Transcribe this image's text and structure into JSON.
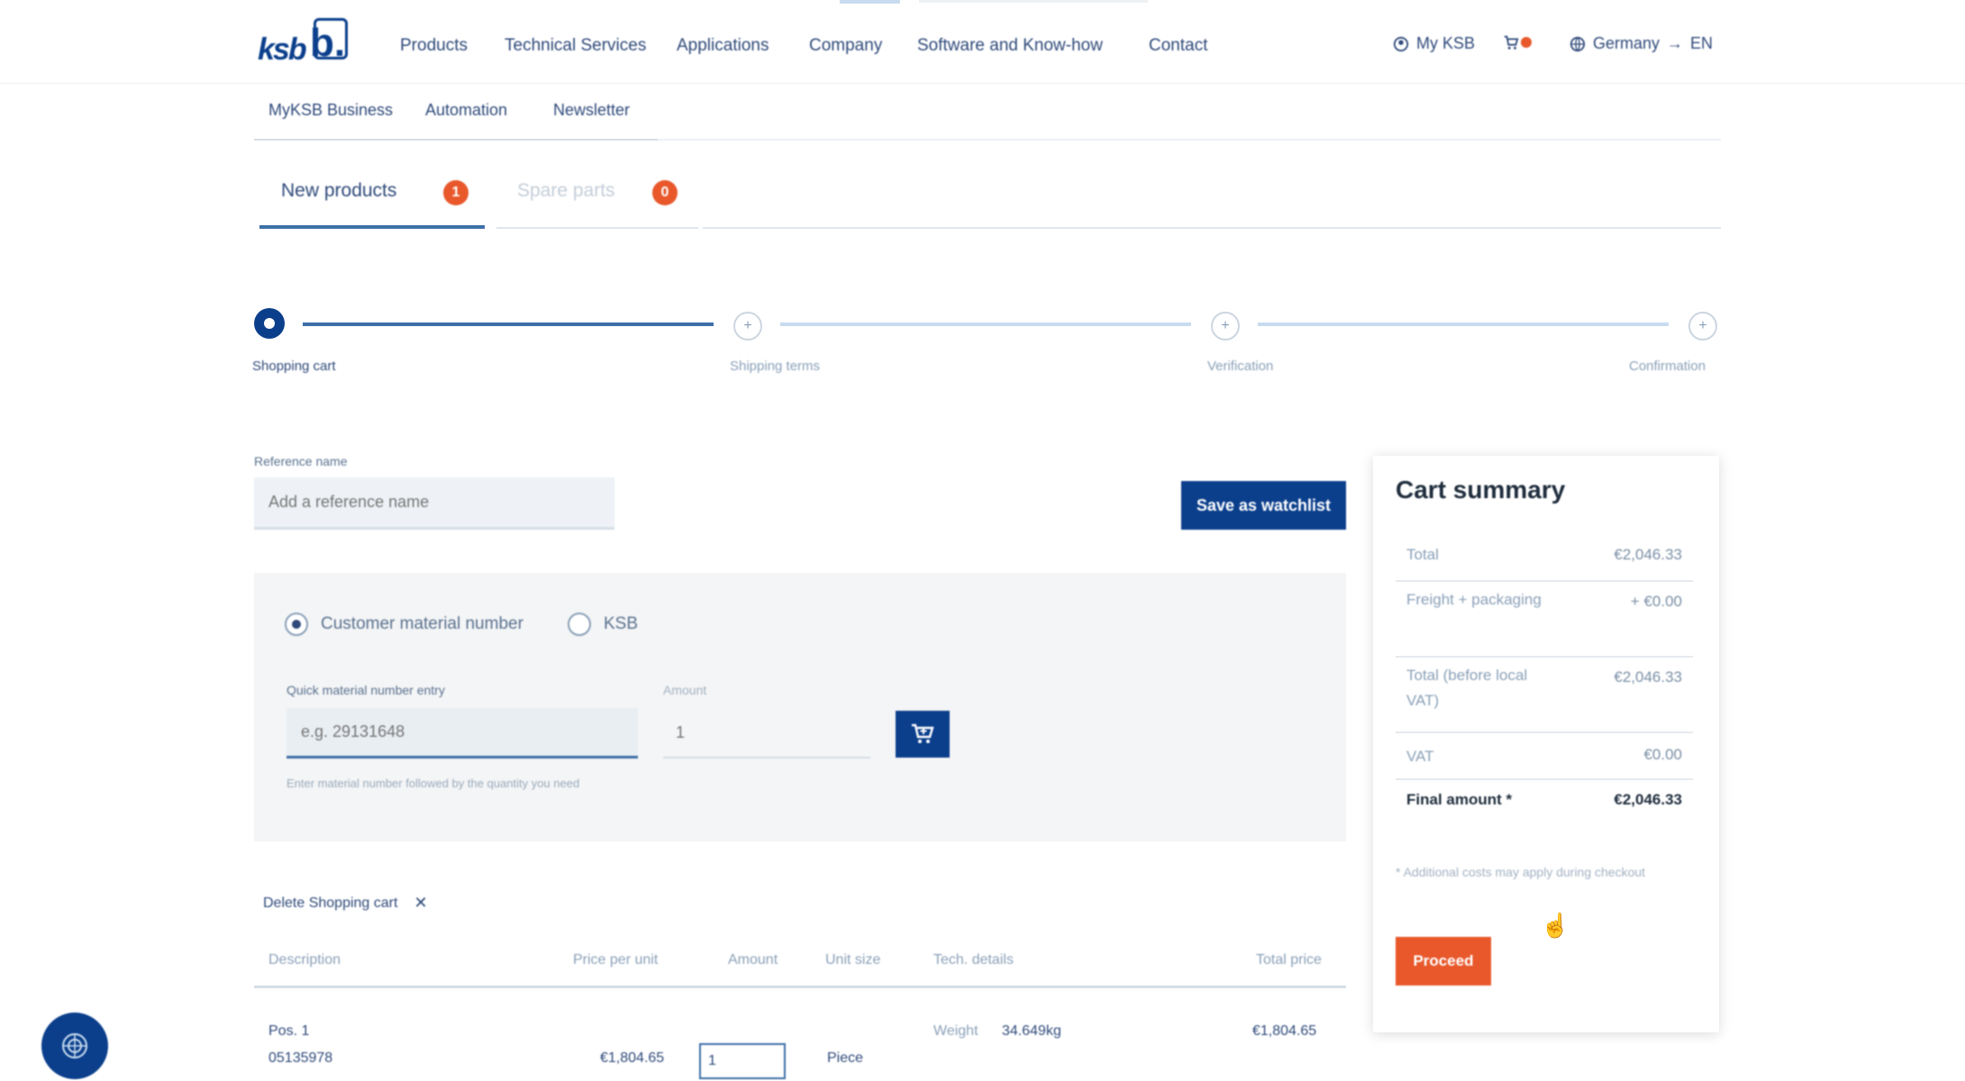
{
  "header": {
    "logo_text": "ksb",
    "logo_mark": "b.",
    "nav": [
      "Products",
      "Technical Services",
      "Applications",
      "Company",
      "Software and Know-how",
      "Contact"
    ],
    "my_ksb": "My KSB",
    "country": "Germany",
    "language": "EN",
    "icons": [
      "user-icon",
      "cart-icon",
      "globe-icon"
    ]
  },
  "subnav": [
    "MyKSB Business",
    "Automation",
    "Newsletter"
  ],
  "tabs": [
    {
      "label": "New products",
      "badge": "1"
    },
    {
      "label": "Spare parts",
      "badge": "0"
    }
  ],
  "stepper": [
    {
      "label": "Shopping cart",
      "active": true
    },
    {
      "label": "Shipping terms",
      "active": false
    },
    {
      "label": "Verification",
      "active": false
    },
    {
      "label": "Confirmation",
      "active": false
    }
  ],
  "reference": {
    "label": "Reference name",
    "placeholder": "Add a reference name"
  },
  "save_watchlist_label": "Save as watchlist",
  "quick_entry": {
    "radio_customer": "Customer material number",
    "radio_ksb": "KSB",
    "material_label": "Quick material number entry",
    "material_placeholder": "e.g. 29131648",
    "amount_label": "Amount",
    "amount_placeholder": "1",
    "hint": "Enter material number followed by the quantity you need"
  },
  "delete_cart_label": "Delete Shopping cart",
  "table": {
    "headers": [
      "Description",
      "Price per unit",
      "Amount",
      "Unit size",
      "Tech. details",
      "Total price"
    ],
    "rows": [
      {
        "pos": "Pos. 1",
        "material": "05135978",
        "price_per_unit": "€1,804.65",
        "amount": "1",
        "unit_size": "Piece",
        "tech_label": "Weight",
        "tech_value": "34.649kg",
        "total": "€1,804.65"
      }
    ]
  },
  "summary": {
    "title": "Cart summary",
    "rows": [
      {
        "label": "Total",
        "value": "€2,046.33"
      },
      {
        "label": "Freight + packaging",
        "value": "+ €0.00"
      },
      {
        "label": "Total (before local VAT)",
        "value": "€2,046.33"
      },
      {
        "label": "VAT",
        "value": "€0.00"
      }
    ],
    "final_label": "Final amount *",
    "final_value": "€2,046.33",
    "note": "* Additional costs may apply during checkout",
    "proceed_label": "Proceed"
  },
  "colors": {
    "brand_blue": "#0b3f8c",
    "accent_orange": "#e8582b"
  }
}
